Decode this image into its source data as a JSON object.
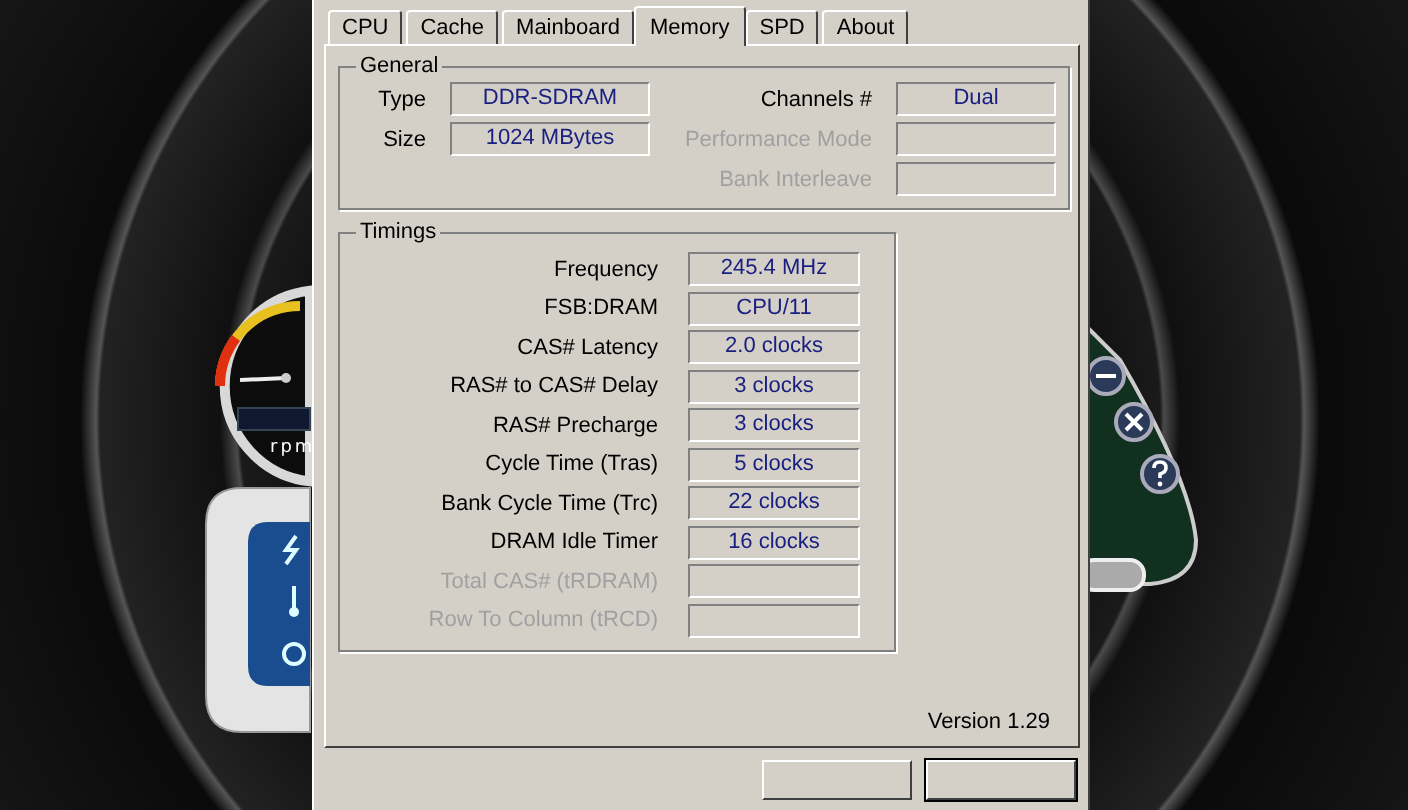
{
  "desktop": {
    "fan_gauge": {
      "unit": "rpm"
    }
  },
  "tabs": [
    {
      "label": "CPU",
      "selected": false
    },
    {
      "label": "Cache",
      "selected": false
    },
    {
      "label": "Mainboard",
      "selected": false
    },
    {
      "label": "Memory",
      "selected": true
    },
    {
      "label": "SPD",
      "selected": false
    },
    {
      "label": "About",
      "selected": false
    }
  ],
  "general": {
    "title": "General",
    "left_fields": [
      {
        "label": "Type",
        "value": "DDR-SDRAM",
        "disabled": false
      },
      {
        "label": "Size",
        "value": "1024 MBytes",
        "disabled": false
      }
    ],
    "right_fields": [
      {
        "label": "Channels #",
        "value": "Dual",
        "disabled": false
      },
      {
        "label": "Performance Mode",
        "disabled": true
      },
      {
        "label": "Bank Interleave",
        "disabled": true
      }
    ]
  },
  "timings": {
    "title": "Timings",
    "fields": [
      {
        "label": "Frequency",
        "value": "245.4 MHz",
        "disabled": false
      },
      {
        "label": "FSB:DRAM",
        "value": "CPU/11",
        "disabled": false
      },
      {
        "label": "CAS# Latency",
        "value": "2.0 clocks",
        "disabled": false
      },
      {
        "label": "RAS# to CAS# Delay",
        "value": "3 clocks",
        "disabled": false
      },
      {
        "label": "RAS# Precharge",
        "value": "3 clocks",
        "disabled": false
      },
      {
        "label": "Cycle Time (Tras)",
        "value": "5 clocks",
        "disabled": false
      },
      {
        "label": "Bank Cycle Time (Trc)",
        "value": "22 clocks",
        "disabled": false
      },
      {
        "label": "DRAM Idle Timer",
        "value": "16 clocks",
        "disabled": false
      },
      {
        "label": "Total CAS# (tRDRAM)",
        "disabled": true
      },
      {
        "label": "Row To Column (tRCD)",
        "disabled": true
      }
    ]
  },
  "version": "Version 1.29"
}
